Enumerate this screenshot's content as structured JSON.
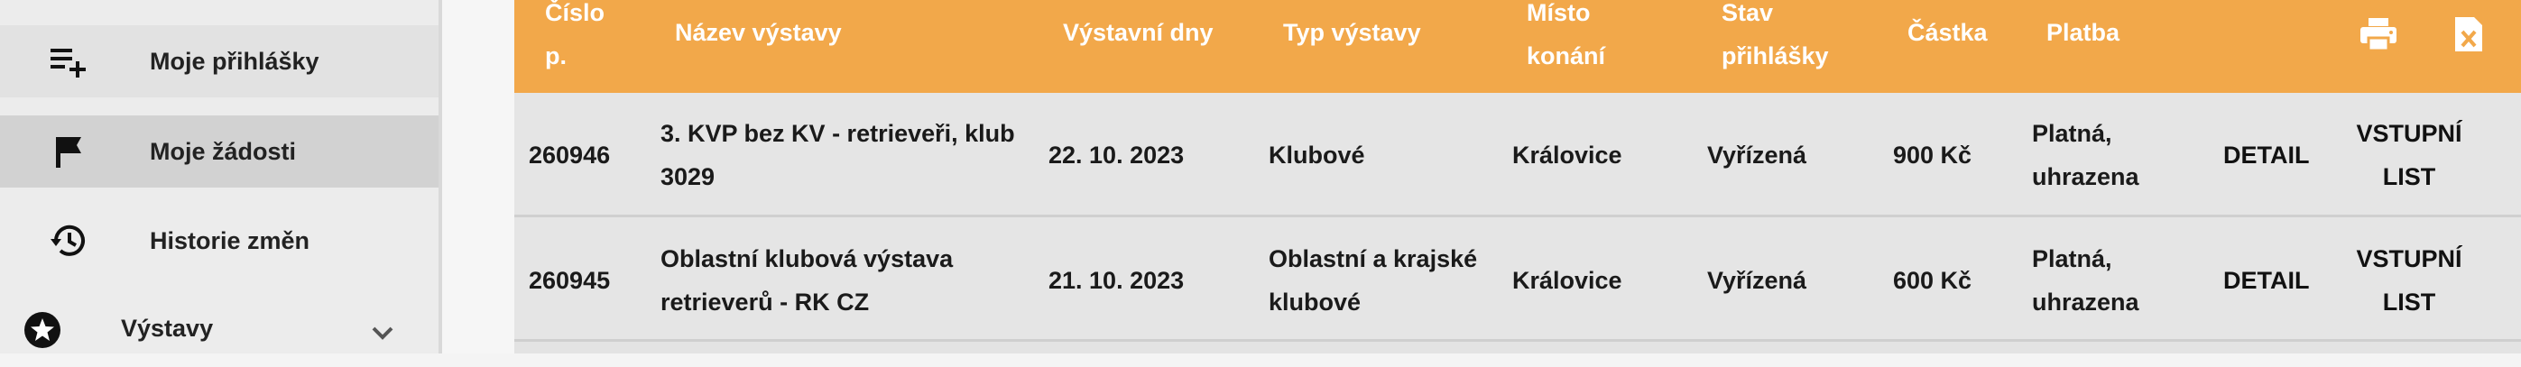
{
  "sidebar": {
    "items": [
      {
        "label": "Moje přihlášky",
        "icon": "playlist-add-icon"
      },
      {
        "label": "Moje žádosti",
        "icon": "flag-icon"
      },
      {
        "label": "Historie změn",
        "icon": "history-icon"
      },
      {
        "label": "Výstavy",
        "icon": "star-circle-icon"
      }
    ]
  },
  "table": {
    "headers": {
      "cislo_line1": "Číslo",
      "cislo_line2": "p.",
      "nazev": "Název výstavy",
      "dny": "Výstavní dny",
      "typ": "Typ výstavy",
      "misto_line1": "Místo",
      "misto_line2": "konání",
      "stav_line1": "Stav",
      "stav_line2": "přihlášky",
      "castka": "Částka",
      "platba": "Platba"
    },
    "rows": [
      {
        "cislo": "260946",
        "nazev_line1": "3. KVP bez KV - retrieveři, klub",
        "nazev_line2": "3029",
        "dny": "22. 10. 2023",
        "typ_line1": "Klubové",
        "typ_line2": "",
        "misto": "Královice",
        "stav": "Vyřízená",
        "castka": "900 Kč",
        "platba_line1": "Platná,",
        "platba_line2": "uhrazena",
        "detail": "DETAIL",
        "vstup_line1": "VSTUPNÍ",
        "vstup_line2": "LIST"
      },
      {
        "cislo": "260945",
        "nazev_line1": "Oblastní klubová výstava",
        "nazev_line2": "retrieverů - RK CZ",
        "dny": "21. 10. 2023",
        "typ_line1": "Oblastní a krajské",
        "typ_line2": "klubové",
        "misto": "Královice",
        "stav": "Vyřízená",
        "castka": "600 Kč",
        "platba_line1": "Platná,",
        "platba_line2": "uhrazena",
        "detail": "DETAIL",
        "vstup_line1": "VSTUPNÍ",
        "vstup_line2": "LIST"
      }
    ]
  },
  "colors": {
    "header_bg": "#f2a84a",
    "sidebar_bg": "#ececec",
    "active_item_bg": "#d2d2d2"
  }
}
